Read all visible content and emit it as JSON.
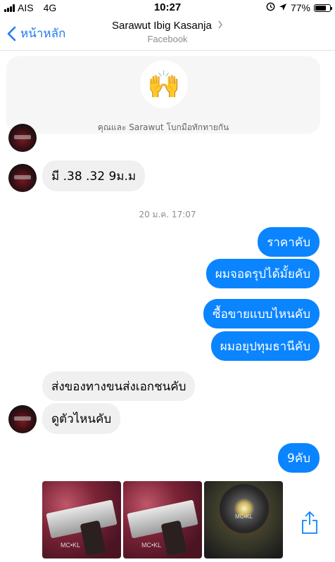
{
  "status_bar": {
    "carrier": "AIS",
    "network": "4G",
    "time": "10:27",
    "battery_percent": "77%",
    "battery_level": 0.77
  },
  "nav": {
    "back_label": "หน้าหลัก",
    "title": "Sarawut Ibig Kasanja",
    "subtitle": "Facebook"
  },
  "wave": {
    "emoji": "🙌",
    "text": "คุณและ Sarawut โบกมือทักทายกัน"
  },
  "messages": [
    {
      "side": "in",
      "text": "มี .38 .32  9ม.ม"
    },
    {
      "side": "out",
      "text": "ราคาคับ"
    },
    {
      "side": "out",
      "text": "ผมจอดรุปได้มั้ยคับ"
    },
    {
      "side": "out",
      "text": "ซื้อขายแบบไหนคับ"
    },
    {
      "side": "out",
      "text": "ผมอยุปทุมธานีคับ"
    },
    {
      "side": "in",
      "text": "ส่งของทางขนส่งเอกชนคับ"
    },
    {
      "side": "in",
      "text": "ดูตัวไหนคับ"
    },
    {
      "side": "out",
      "text": "9คับ"
    }
  ],
  "timestamp": "20 ม.ค. 17:07",
  "photos": [
    {
      "watermark": "MC•KL"
    },
    {
      "watermark": "MC•KL"
    },
    {
      "watermark": "MC•KL"
    }
  ],
  "colors": {
    "accent": "#0a84ff",
    "back_link": "#1f7bf2",
    "incoming_bubble": "#f0f0f0"
  },
  "icons": [
    "signal-icon",
    "back-chevron-icon",
    "title-chevron-icon",
    "alarm-icon",
    "location-icon",
    "battery-icon",
    "raising-hands-icon",
    "share-icon"
  ]
}
